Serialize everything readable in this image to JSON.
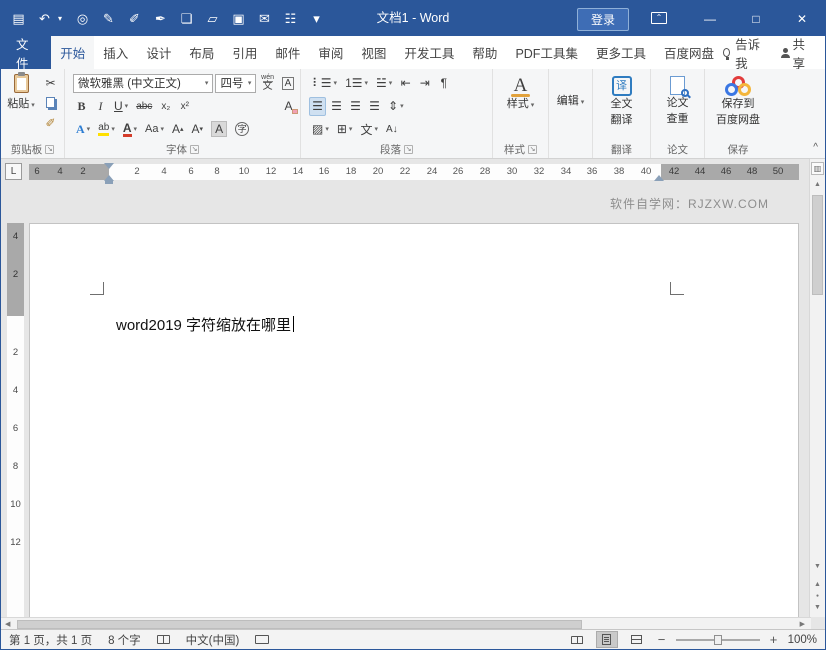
{
  "titlebar": {
    "title": "文档1 - Word",
    "login": "登录",
    "qat": [
      {
        "name": "grid-icon",
        "glyph": "▤"
      },
      {
        "name": "undo-icon",
        "glyph": "↶"
      },
      {
        "name": "print-preview-icon",
        "glyph": "◎"
      },
      {
        "name": "pen-icon",
        "glyph": "✎"
      },
      {
        "name": "edit-document-icon",
        "glyph": "✐"
      },
      {
        "name": "ink-icon",
        "glyph": "✒"
      },
      {
        "name": "new-document-icon",
        "glyph": "❏"
      },
      {
        "name": "open-folder-icon",
        "glyph": "▱"
      },
      {
        "name": "save-icon",
        "glyph": "▣"
      },
      {
        "name": "email-icon",
        "glyph": "✉"
      },
      {
        "name": "print-icon",
        "glyph": "☷"
      },
      {
        "name": "qat-more-icon",
        "glyph": "▾"
      }
    ],
    "minimize": "—",
    "maximize": "□",
    "close": "✕"
  },
  "tabs": {
    "file": "文件",
    "items": [
      "开始",
      "插入",
      "设计",
      "布局",
      "引用",
      "邮件",
      "审阅",
      "视图",
      "开发工具",
      "帮助",
      "PDF工具集",
      "更多工具",
      "百度网盘"
    ],
    "tell_me": "告诉我",
    "share": "共享"
  },
  "ribbon": {
    "clipboard": {
      "paste": "粘贴",
      "label": "剪贴板",
      "cut_glyph": "✂",
      "painter_glyph": "✐"
    },
    "font": {
      "label": "字体",
      "name": "微软雅黑 (中文正文)",
      "size": "四号",
      "pinyin_top": "wén",
      "pinyin_bottom": "文",
      "border_a": "A",
      "bold": "B",
      "italic": "I",
      "underline": "U",
      "strike": "abc",
      "subscript": "x₂",
      "superscript": "x²",
      "clear": "A",
      "effects": "A",
      "highlight": "ab",
      "color": "A",
      "case": "Aa",
      "grow": "A",
      "shrink": "A",
      "shading": "A",
      "enclose": "字"
    },
    "paragraph": {
      "label": "段落",
      "bullets": "⠇☰",
      "numbering": "1☰",
      "multilevel": "☱",
      "dec_indent": "⇤",
      "inc_indent": "⇥",
      "marks": "¶",
      "align": "☰",
      "spacing": "⇕",
      "shading": "▨",
      "borders": "⊞",
      "asian": "文",
      "sort": "A↓"
    },
    "styles": {
      "label": "样式",
      "button": "样式",
      "letter": "A"
    },
    "editing": {
      "button": "编辑"
    },
    "translate": {
      "label": "翻译",
      "line1": "全文",
      "line2": "翻译",
      "icon_char": "译"
    },
    "paper_check": {
      "label": "论文",
      "line1": "论文",
      "line2": "查重"
    },
    "baidu_save": {
      "label": "保存",
      "line1": "保存到",
      "line2": "百度网盘"
    }
  },
  "ruler": {
    "tab_selector": "L",
    "left_numbers": [
      "6",
      "4",
      "2"
    ],
    "numbers": [
      "2",
      "4",
      "6",
      "8",
      "10",
      "12",
      "14",
      "16",
      "18",
      "20",
      "22",
      "24",
      "26",
      "28",
      "30",
      "32",
      "34",
      "36",
      "38",
      "40"
    ],
    "right_numbers": [
      "42",
      "44",
      "46",
      "48",
      "50"
    ],
    "v_margin_numbers": [
      "4",
      "2"
    ],
    "v_numbers": [
      "2",
      "4",
      "6",
      "8",
      "10",
      "12"
    ]
  },
  "document": {
    "watermark": "软件自学网：RJZXW.COM",
    "text": "word2019 字符缩放在哪里"
  },
  "statusbar": {
    "page_info": "第 1 页，共 1 页",
    "word_count": "8 个字",
    "language": "中文(中国)",
    "zoom": "100%"
  }
}
